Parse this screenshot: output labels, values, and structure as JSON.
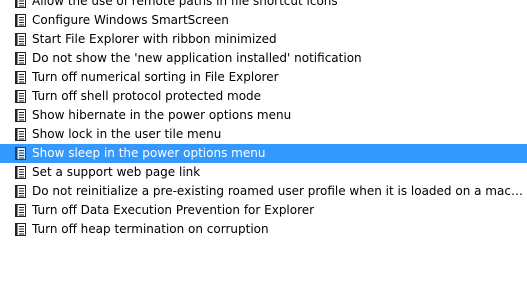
{
  "policy_list": {
    "item_icon": "policy-setting-icon",
    "selected_color": "#3399ff",
    "items": [
      {
        "label": "Allow the use of remote paths in file shortcut icons",
        "selected": false
      },
      {
        "label": "Configure Windows SmartScreen",
        "selected": false
      },
      {
        "label": "Start File Explorer with ribbon minimized",
        "selected": false
      },
      {
        "label": "Do not show the 'new application installed' notification",
        "selected": false
      },
      {
        "label": "Turn off numerical sorting in File Explorer",
        "selected": false
      },
      {
        "label": "Turn off shell protocol protected mode",
        "selected": false
      },
      {
        "label": "Show hibernate in the power options menu",
        "selected": false
      },
      {
        "label": "Show lock in the user tile menu",
        "selected": false
      },
      {
        "label": "Show sleep in the power options menu",
        "selected": true
      },
      {
        "label": "Set a support web page link",
        "selected": false
      },
      {
        "label": "Do not reinitialize a pre-existing roamed user profile when it is loaded on a machine for the fi...",
        "selected": false
      },
      {
        "label": "Turn off Data Execution Prevention for Explorer",
        "selected": false
      },
      {
        "label": "Turn off heap termination on corruption",
        "selected": false
      }
    ]
  }
}
